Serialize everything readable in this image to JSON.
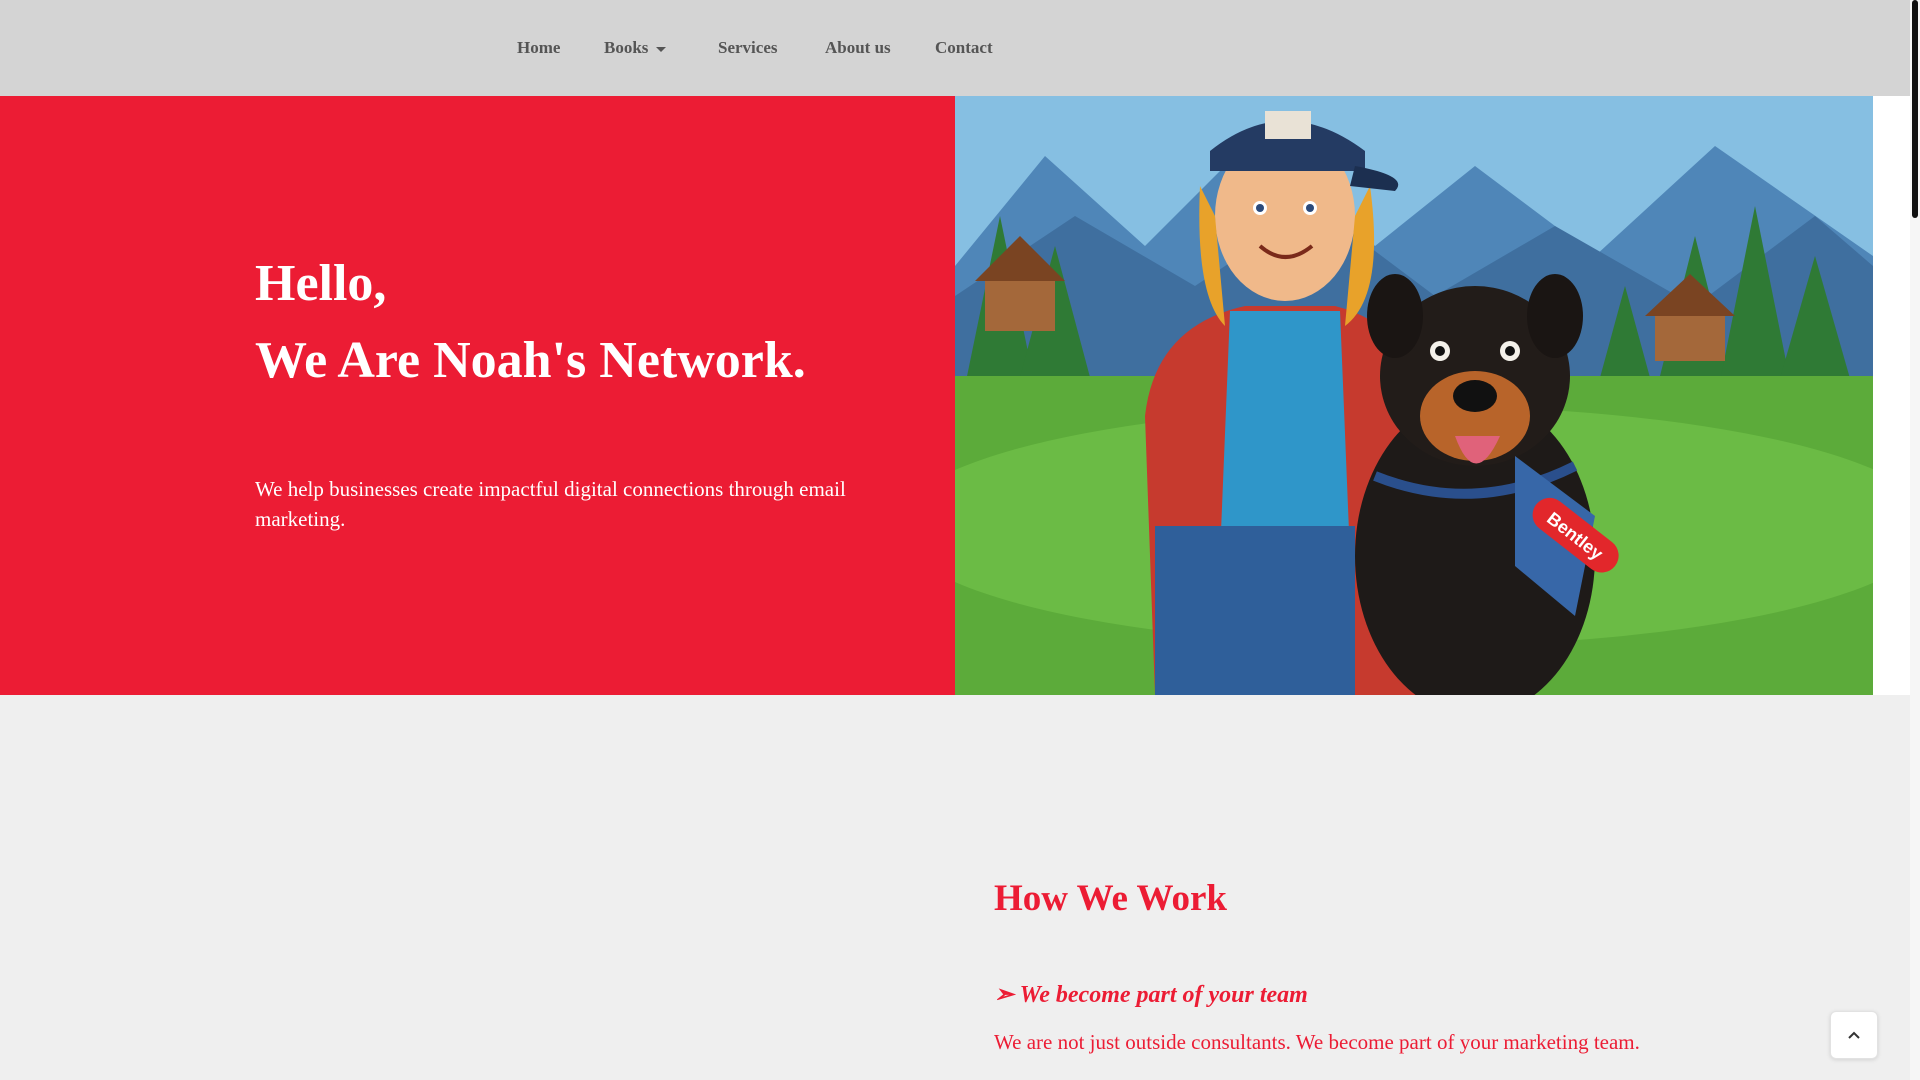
{
  "nav": {
    "items": [
      {
        "label": "Home"
      },
      {
        "label": "Books",
        "dropdown": true
      },
      {
        "label": "Services"
      },
      {
        "label": "About us"
      },
      {
        "label": "Contact"
      }
    ]
  },
  "hero": {
    "greeting": "Hello,",
    "title": "We Are Noah's Network.",
    "description": "We help businesses create impactful digital connections through email marketing.",
    "image_badge_text": "Bentley"
  },
  "how_we_work": {
    "title": "How We Work",
    "points": [
      {
        "heading": "➣ We become part of your team",
        "text": "We are not just outside consultants. We become part of your marketing team."
      }
    ]
  },
  "colors": {
    "accent": "#ec1c34",
    "nav_bg": "#d4d4d4",
    "page_bg": "#efefef"
  },
  "icons": {
    "dropdown": "caret-down-icon",
    "back_to_top": "chevron-up-icon"
  }
}
